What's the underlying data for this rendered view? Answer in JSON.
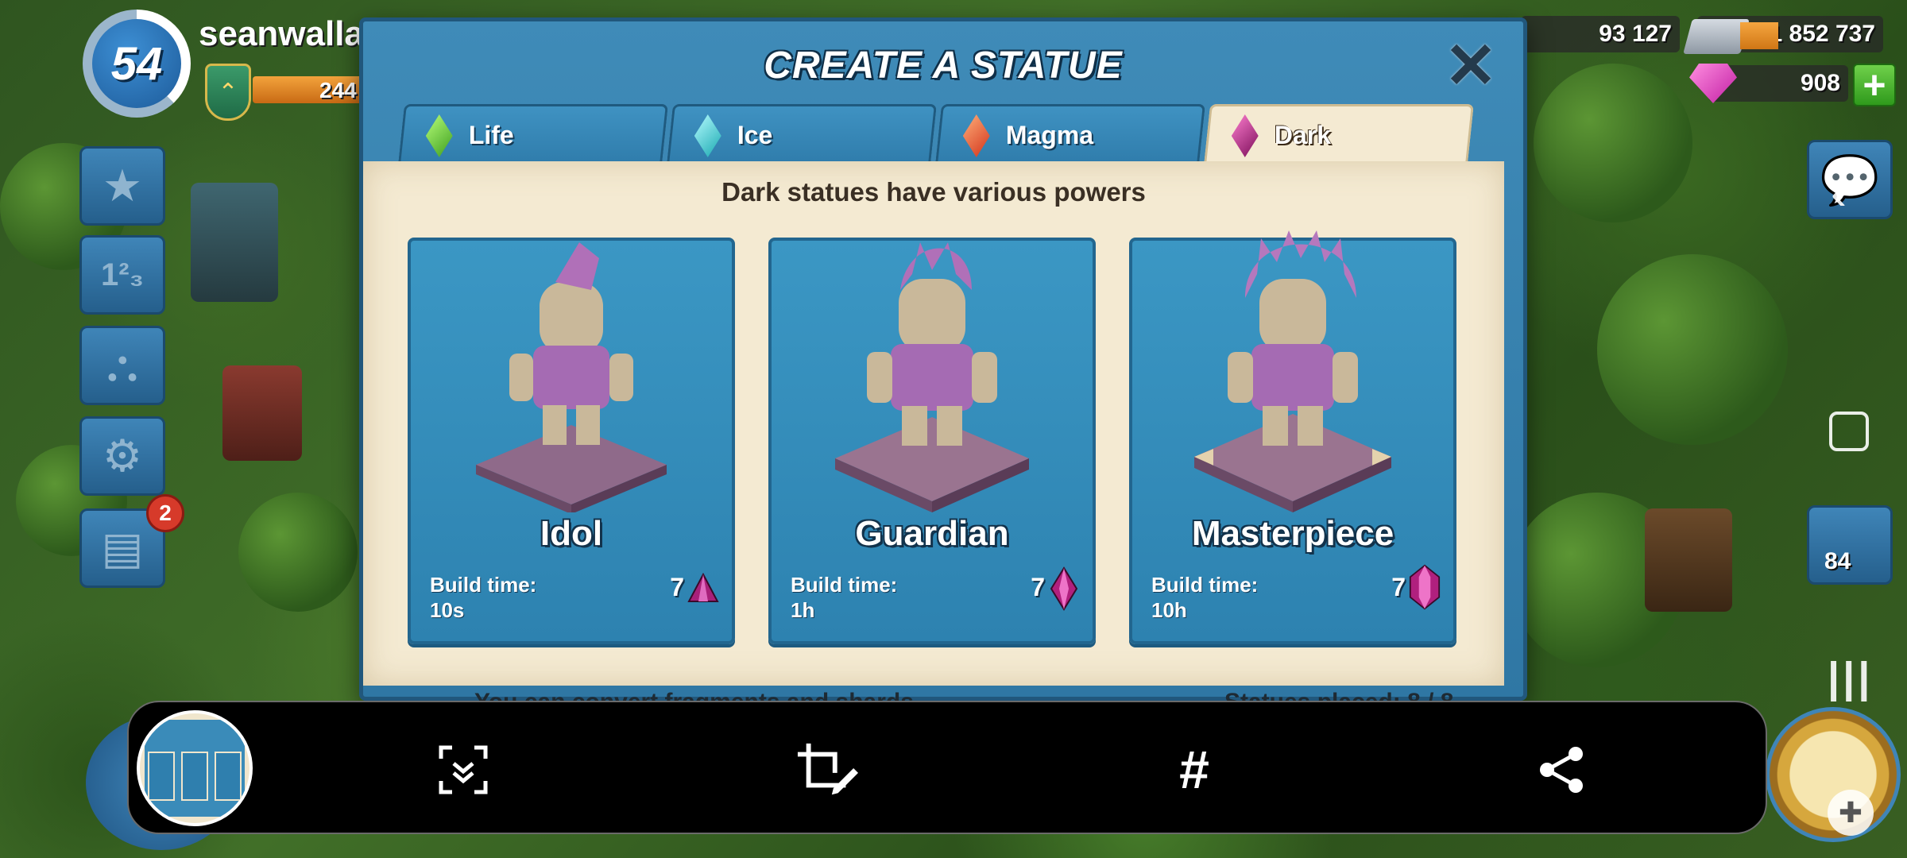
{
  "hud": {
    "level": "54",
    "player_name": "seanwalla",
    "rank_value": "244"
  },
  "resources": {
    "gold": "93 127",
    "steel": "1 852 737",
    "gems": "908"
  },
  "notifications": {
    "news_count": "2",
    "troop_count": "84"
  },
  "dialog": {
    "title": "CREATE A STATUE",
    "subtitle": "Dark statues have various powers",
    "footer_left": "You can convert fragments and shards",
    "footer_right": "Statues placed: 8 / 8",
    "tabs": [
      {
        "label": "Life",
        "color": "#5fce3a",
        "active": false
      },
      {
        "label": "Ice",
        "color": "#2fd2d6",
        "active": false
      },
      {
        "label": "Magma",
        "color": "#ef5a2a",
        "active": false
      },
      {
        "label": "Dark",
        "color": "#b5287e",
        "active": true
      }
    ],
    "cards": [
      {
        "name": "Idol",
        "build_label": "Build time:",
        "build_time": "10s",
        "cost": "7",
        "cost_icon": "dark-fragment-icon"
      },
      {
        "name": "Guardian",
        "build_label": "Build time:",
        "build_time": "1h",
        "cost": "7",
        "cost_icon": "dark-shard-icon"
      },
      {
        "name": "Masterpiece",
        "build_label": "Build time:",
        "build_time": "10h",
        "cost": "7",
        "cost_icon": "dark-crystal-icon"
      }
    ]
  },
  "toolbar": {
    "icons": [
      "screenshot-preview-thumbnail",
      "scroll-capture-icon",
      "crop-edit-icon",
      "hashtag-icon",
      "share-icon"
    ]
  }
}
